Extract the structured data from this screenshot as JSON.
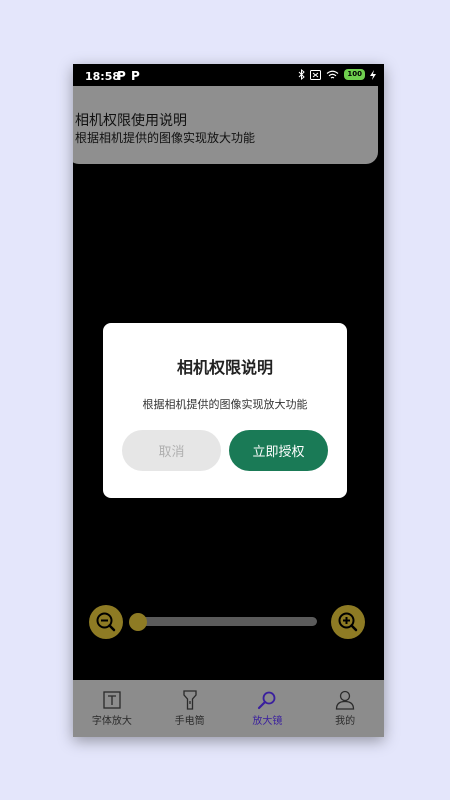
{
  "status_bar": {
    "time": "18:58",
    "notif_icons": [
      "P",
      "P"
    ],
    "battery": "100"
  },
  "permission_banner": {
    "title": "相机权限使用说明",
    "description": "根据相机提供的图像实现放大功能"
  },
  "dialog": {
    "title": "相机权限说明",
    "message": "根据相机提供的图像实现放大功能",
    "cancel_label": "取消",
    "confirm_label": "立即授权"
  },
  "zoom": {
    "level_fraction": 0.0
  },
  "bottom_nav": {
    "items": [
      {
        "label": "字体放大",
        "icon": "text-size-icon"
      },
      {
        "label": "手电筒",
        "icon": "flashlight-icon"
      },
      {
        "label": "放大镜",
        "icon": "magnifier-icon"
      },
      {
        "label": "我的",
        "icon": "profile-icon"
      }
    ],
    "active_index": 2
  },
  "colors": {
    "accent_green": "#1a7a56",
    "zoom_gold": "#8e7b24",
    "active_nav": "#3a1f9e",
    "background": "#e4e6fb"
  }
}
